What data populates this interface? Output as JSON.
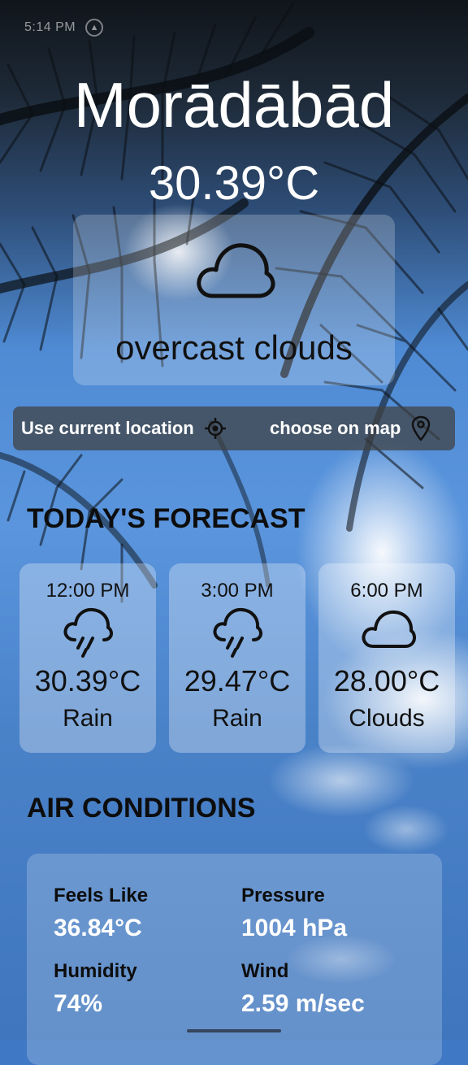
{
  "status_bar": {
    "time": "5:14 PM",
    "icon": "navigation-icon"
  },
  "weather": {
    "city": "Morādābād",
    "temperature": "30.39°C",
    "condition": "overcast clouds",
    "condition_icon": "cloud-icon"
  },
  "location": {
    "current_label": "Use current location",
    "current_icon": "crosshair-icon",
    "map_label": "choose on map",
    "map_icon": "map-pin-icon"
  },
  "forecast": {
    "title": "TODAY'S FORECAST",
    "items": [
      {
        "time": "12:00 PM",
        "icon": "rain-cloud-icon",
        "temp": "30.39°C",
        "desc": "Rain"
      },
      {
        "time": "3:00 PM",
        "icon": "rain-cloud-icon",
        "temp": "29.47°C",
        "desc": "Rain"
      },
      {
        "time": "6:00 PM",
        "icon": "cloud-icon",
        "temp": "28.00°C",
        "desc": "Clouds"
      }
    ]
  },
  "air": {
    "title": "AIR CONDITIONS",
    "items": [
      {
        "label": "Feels Like",
        "value": "36.84°C"
      },
      {
        "label": "Pressure",
        "value": "1004 hPa"
      },
      {
        "label": "Humidity",
        "value": "74%"
      },
      {
        "label": "Wind",
        "value": "2.59 m/sec"
      }
    ]
  },
  "colors": {
    "card_text": "#111111",
    "value_text": "#ffffff",
    "location_bar": "#404040"
  }
}
